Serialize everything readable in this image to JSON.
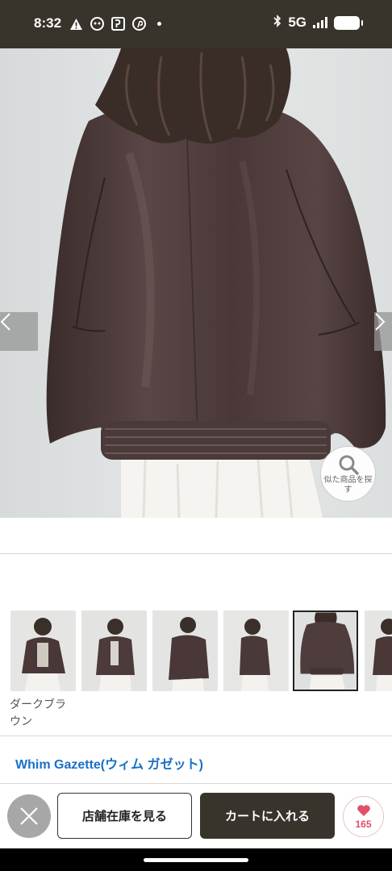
{
  "status_bar": {
    "time": "8:32",
    "network": "5G",
    "icons": [
      "alert-icon",
      "app-face-icon",
      "app-p-icon",
      "pinterest-icon",
      "bluetooth-icon",
      "signal-icon",
      "battery-icon"
    ]
  },
  "gallery": {
    "prev_icon": "chevron-left-icon",
    "next_icon": "chevron-right-icon",
    "similar_button_label": "似た商品を探す",
    "thumbnails_count": 6,
    "selected_thumbnail": 5,
    "color_caption": "ダークブラウン"
  },
  "product": {
    "brand": "Whim Gazette(ウィム ガゼット)"
  },
  "actions": {
    "close_icon": "close-icon",
    "store_stock_label": "店舗在庫を見る",
    "add_to_cart_label": "カートに入れる",
    "favorite_count": "165"
  },
  "colors": {
    "status_bar_bg": "#38342c",
    "primary_button_bg": "#38342c",
    "brand_link": "#1a70c7",
    "favorite_accent": "#e0506a"
  }
}
